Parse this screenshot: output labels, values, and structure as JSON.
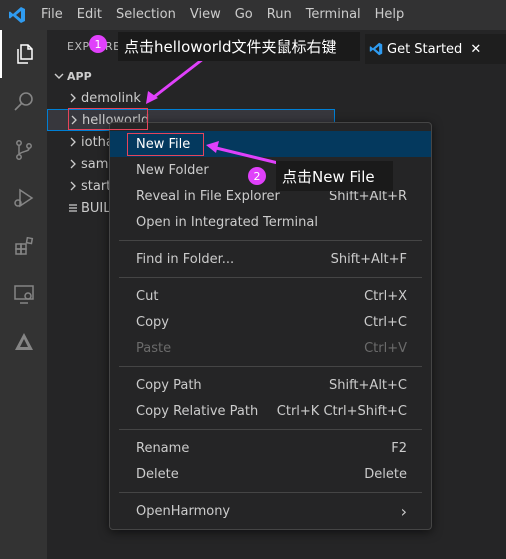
{
  "menubar": {
    "items": [
      "File",
      "Edit",
      "Selection",
      "View",
      "Go",
      "Run",
      "Terminal",
      "Help"
    ]
  },
  "activity_bar": {
    "icons": [
      "files-icon",
      "search-icon",
      "source-control-icon",
      "run-debug-icon",
      "extensions-icon",
      "remote-explorer-icon",
      "deveco-icon"
    ]
  },
  "sidebar": {
    "header": "EXPLORER",
    "section": "APP",
    "items": [
      {
        "label": "demolink",
        "type": "folder"
      },
      {
        "label": "helloworld",
        "type": "folder"
      },
      {
        "label": "iotha",
        "type": "folder"
      },
      {
        "label": "samg",
        "type": "folder"
      },
      {
        "label": "startu",
        "type": "folder"
      },
      {
        "label": "BUILD",
        "type": "file"
      }
    ]
  },
  "editor": {
    "tab_label": "Get Started",
    "tab_close": "✕"
  },
  "context_menu": {
    "groups": [
      [
        {
          "label": "New File",
          "shortcut": ""
        },
        {
          "label": "New Folder",
          "shortcut": ""
        },
        {
          "label": "Reveal in File Explorer",
          "shortcut": "Shift+Alt+R"
        },
        {
          "label": "Open in Integrated Terminal",
          "shortcut": ""
        }
      ],
      [
        {
          "label": "Find in Folder...",
          "shortcut": "Shift+Alt+F"
        }
      ],
      [
        {
          "label": "Cut",
          "shortcut": "Ctrl+X"
        },
        {
          "label": "Copy",
          "shortcut": "Ctrl+C"
        },
        {
          "label": "Paste",
          "shortcut": "Ctrl+V"
        }
      ],
      [
        {
          "label": "Copy Path",
          "shortcut": "Shift+Alt+C"
        },
        {
          "label": "Copy Relative Path",
          "shortcut": "Ctrl+K Ctrl+Shift+C"
        }
      ],
      [
        {
          "label": "Rename",
          "shortcut": "F2"
        },
        {
          "label": "Delete",
          "shortcut": "Delete"
        }
      ],
      [
        {
          "label": "OpenHarmony",
          "shortcut": "›"
        }
      ]
    ]
  },
  "annotations": {
    "step1_number": "1",
    "step1_text": "点击helloworld文件夹鼠标右键",
    "step2_number": "2",
    "step2_text": "点击New File",
    "accent_color": "#e040fb",
    "box_color": "#e5445a"
  }
}
